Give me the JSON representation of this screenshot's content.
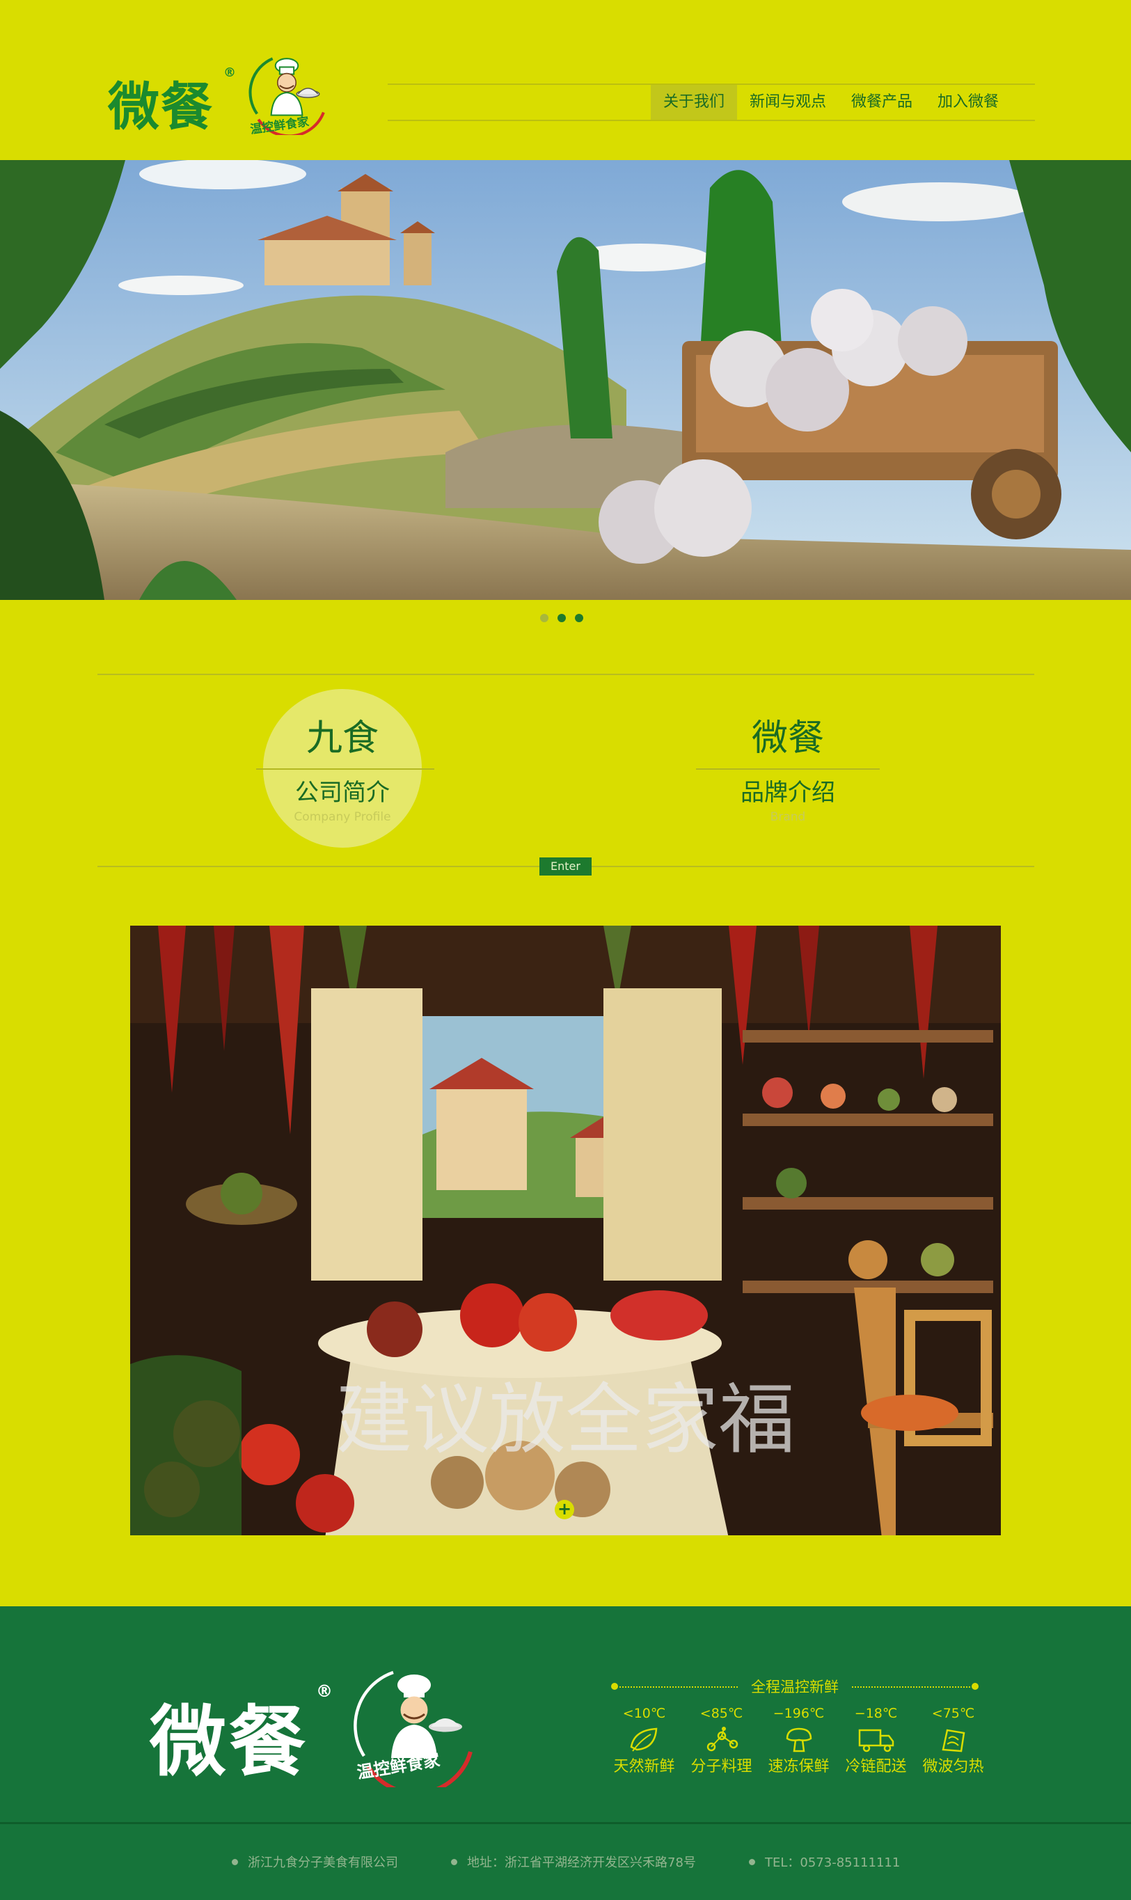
{
  "header": {
    "brand": "微餐",
    "registered": "®",
    "tagline": "温控鲜食家"
  },
  "nav": {
    "items": [
      "关于我们",
      "新闻与观点",
      "微餐产品",
      "加入微餐"
    ],
    "active_index": 0
  },
  "hero": {
    "slides_total": 3,
    "active_slide": 2
  },
  "intro": {
    "left": {
      "title": "九食",
      "subtitle": "公司简介",
      "subtitle_en": "Company Profile"
    },
    "right": {
      "title": "微餐",
      "subtitle": "品牌介绍",
      "subtitle_en": "Brand"
    },
    "enter_label": "Enter"
  },
  "photo": {
    "caption": "建议放全家福",
    "plus": "+"
  },
  "footer": {
    "brand": "微餐",
    "registered": "®",
    "tagline": "温控鲜食家",
    "features_title": "全程温控新鲜",
    "features": [
      {
        "temp": "<10℃",
        "label": "天然新鲜",
        "icon": "leaf-icon"
      },
      {
        "temp": "<85℃",
        "label": "分子料理",
        "icon": "molecule-icon"
      },
      {
        "temp": "−196℃",
        "label": "速冻保鲜",
        "icon": "mushroom-cloud-icon"
      },
      {
        "temp": "−18℃",
        "label": "冷链配送",
        "icon": "truck-icon"
      },
      {
        "temp": "<75℃",
        "label": "微波匀热",
        "icon": "microwave-icon"
      }
    ],
    "company": "浙江九食分子美食有限公司",
    "address": "地址：浙江省平湖经济开发区兴禾路78号",
    "tel": "TEL：0573-85111111"
  },
  "colors": {
    "background": "#d9dd00",
    "brand_green": "#1b8a2e",
    "footer_green": "#16743a",
    "accent_yellow": "#d9dd00"
  }
}
